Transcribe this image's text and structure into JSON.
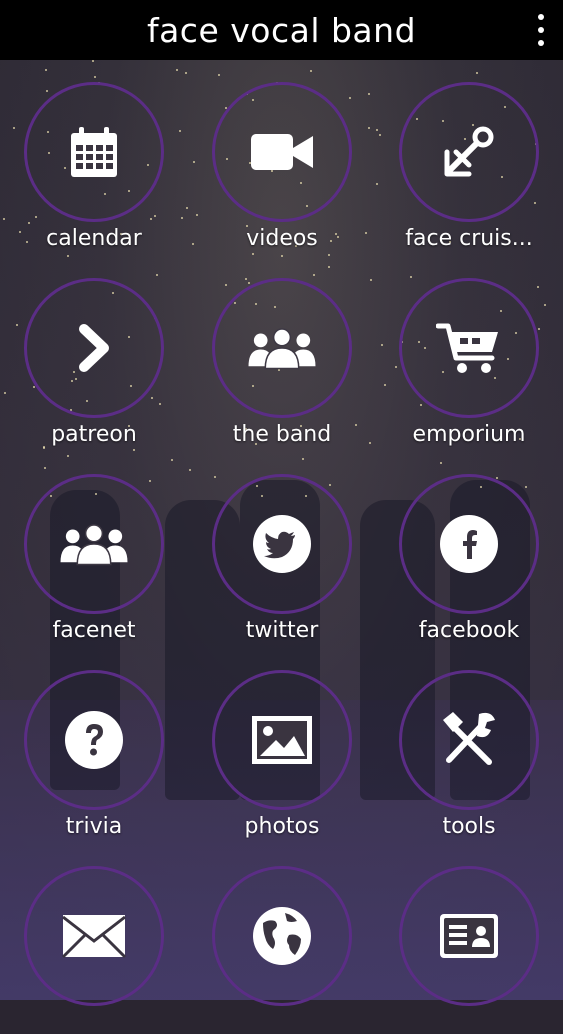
{
  "app": {
    "title": "face vocal band"
  },
  "menu": {
    "icon": "overflow-menu-icon"
  },
  "colors": {
    "topbar": "#000000",
    "ring": "#5b2d86",
    "label": "#ffffff"
  },
  "tiles": [
    {
      "label": "calendar",
      "icon": "calendar-icon"
    },
    {
      "label": "videos",
      "icon": "video-camera-icon"
    },
    {
      "label": "face cruis...",
      "icon": "anchor-icon"
    },
    {
      "label": "patreon",
      "icon": "chevron-right-icon"
    },
    {
      "label": "the band",
      "icon": "group-icon"
    },
    {
      "label": "emporium",
      "icon": "shopping-cart-icon"
    },
    {
      "label": "facenet",
      "icon": "group-icon"
    },
    {
      "label": "twitter",
      "icon": "twitter-icon"
    },
    {
      "label": "facebook",
      "icon": "facebook-icon"
    },
    {
      "label": "trivia",
      "icon": "question-icon"
    },
    {
      "label": "photos",
      "icon": "photo-icon"
    },
    {
      "label": "tools",
      "icon": "tools-icon"
    },
    {
      "label": "",
      "icon": "envelope-icon"
    },
    {
      "label": "",
      "icon": "globe-icon"
    },
    {
      "label": "",
      "icon": "contact-card-icon"
    }
  ]
}
